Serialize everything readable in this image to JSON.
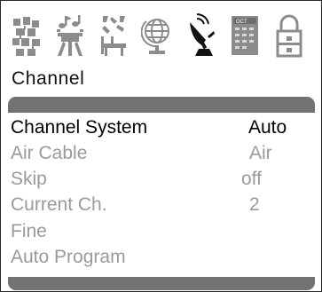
{
  "colors": {
    "frame_border": "#2a2a2a",
    "icon_gray": "#8c8c8c",
    "band": "#727272",
    "selected_text": "#000000",
    "dim_text": "#9a9a9a",
    "title_text": "#111111"
  },
  "icon_bar": {
    "icons": [
      {
        "name": "picture-icon",
        "state": "inactive"
      },
      {
        "name": "sound-icon",
        "state": "inactive"
      },
      {
        "name": "function-icon",
        "state": "inactive"
      },
      {
        "name": "language-globe-icon",
        "state": "inactive"
      },
      {
        "name": "channel-satellite-icon",
        "state": "active"
      },
      {
        "name": "time-icon",
        "state": "inactive"
      },
      {
        "name": "lock-icon",
        "state": "inactive"
      }
    ],
    "time_icon_text": "OCT"
  },
  "section": {
    "title": "Channel"
  },
  "menu": {
    "items": [
      {
        "label": "Channel System",
        "value": "Auto",
        "selected": true
      },
      {
        "label": "Air Cable",
        "value": "Air",
        "selected": false
      },
      {
        "label": "Skip",
        "value": "off",
        "selected": false
      },
      {
        "label": "Current Ch.",
        "value": "2",
        "selected": false
      },
      {
        "label": "Fine",
        "value": "",
        "selected": false
      },
      {
        "label": "Auto Program",
        "value": "",
        "selected": false
      }
    ]
  }
}
